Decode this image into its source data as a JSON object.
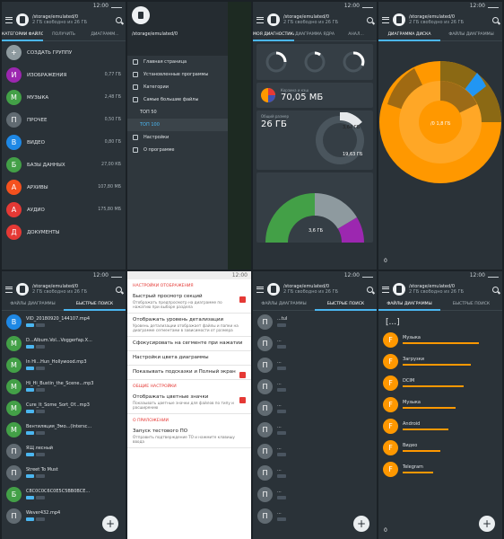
{
  "status": {
    "time": "12:00"
  },
  "header": {
    "path": "/storage/emulated/0",
    "sub": "2 ГБ свободно из 26 ГБ"
  },
  "panel1": {
    "tabs": [
      "КАТЕГОРИИ ФАЙЛОВ",
      "ПОЛУЧИТЬ",
      "ДИАГРАММ..."
    ],
    "items": [
      {
        "letter": "+",
        "label": "СОЗДАТЬ ГРУППУ",
        "size": "",
        "color": "#8e9a9f"
      },
      {
        "letter": "И",
        "label": "ИЗОБРАЖЕНИЯ",
        "size": "0,77 ГБ",
        "color": "#9c27b0"
      },
      {
        "letter": "М",
        "label": "МУЗЫКА",
        "size": "2,48 ГБ",
        "color": "#43a047"
      },
      {
        "letter": "П",
        "label": "ПРОЧЕЕ",
        "size": "0,50 ГБ",
        "color": "#616b72"
      },
      {
        "letter": "В",
        "label": "ВИДЕО",
        "size": "0,80 ГБ",
        "color": "#1e88e5"
      },
      {
        "letter": "Б",
        "label": "БАЗЫ ДАННЫХ",
        "size": "27,00 КБ",
        "color": "#43a047"
      },
      {
        "letter": "А",
        "label": "АРХИВЫ",
        "size": "107,80 МБ",
        "color": "#f4511e"
      },
      {
        "letter": "А",
        "label": "АУДИО",
        "size": "175,80 МБ",
        "color": "#e53935"
      },
      {
        "letter": "Д",
        "label": "ДОКУМЕНТЫ",
        "size": "",
        "color": "#e53935"
      }
    ]
  },
  "panel2": {
    "path": "/storage/emulated/0",
    "items": [
      "Главная страница",
      "Установленные программы",
      "Категории",
      "Самые большие файлы",
      "ТОП 50",
      "ТОП 100",
      "Настройки",
      "О программе"
    ]
  },
  "panel3": {
    "tabs": [
      "МОЯ ДИАГНОСТИКА",
      "ДИАГРАММА ЯДРА",
      "АНАЛ..."
    ],
    "trash_size": "70,05 МБ",
    "trash_label": "Корзина и кэш",
    "total_size": "26 ГБ",
    "total_label": "Общий размер",
    "free_size": "3,64 ГБ",
    "used_size": "19,63 ГБ",
    "free_label": "Свободно",
    "used_label": "Занято",
    "folder_size": "3,6 ГБ"
  },
  "panel4": {
    "tabs": [
      "ДИАГРАММА ДИСКА",
      "ФАЙЛЫ ДИАГРАММЫ"
    ],
    "center_label": "/0 1,8 ГБ",
    "bottom": "0"
  },
  "panel5": {
    "tabs": [
      "ФАЙЛЫ ДИАГРАММЫ",
      "БЫСТРЫЕ ПОИСК"
    ],
    "rows": [
      {
        "letter": "В",
        "name": "VID_20180920_144107.mp4",
        "color": "#1e88e5"
      },
      {
        "letter": "М",
        "name": "D...Album.Vol...Voggerfap.Х...",
        "color": "#43a047"
      },
      {
        "letter": "М",
        "name": "In Hi...Hun_Hollywood.mp3",
        "color": "#43a047"
      },
      {
        "letter": "М",
        "name": "Hi_Hi_Bustin_the_Scene...mp3",
        "color": "#43a047"
      },
      {
        "letter": "М",
        "name": "Cure_It_Some_Sort_Of...mp3",
        "color": "#43a047"
      },
      {
        "letter": "М",
        "name": "Вентиляция_Эмо...(Intersc...",
        "color": "#43a047"
      },
      {
        "letter": "П",
        "name": "ЯЩ лесный",
        "color": "#616b72"
      },
      {
        "letter": "П",
        "name": "Street To Must",
        "color": "#616b72"
      },
      {
        "letter": "Б",
        "name": "C8C0C0C6C0E5C5BB0BCE...",
        "color": "#43a047"
      },
      {
        "letter": "П",
        "name": "Wever432.mp4",
        "color": "#616b72"
      }
    ]
  },
  "panel6": {
    "head": "НАСТРОЙКИ ОТОБРАЖЕНИЯ",
    "blocks": [
      {
        "t": "Быстрый просмотр секций",
        "d": "Отображать предпросмотр на диаграмме по нажатию при выборе раздела",
        "chk": true
      },
      {
        "t": "Отображать уровень детализации",
        "d": "Уровень детализации отображает файлы и папки на диаграмме сегментами в зависимости от размера",
        "chk": false
      },
      {
        "t": "Сфокусировать на сегменте при нажатии",
        "d": "",
        "chk": false
      },
      {
        "t": "Настройки цвета диаграммы",
        "d": "",
        "chk": false
      },
      {
        "t": "Показывать подсказки и Полный экран",
        "d": "",
        "chk": true
      }
    ],
    "head2": "ОБЩИЕ НАСТРОЙКИ",
    "block2": {
      "t": "Отображать цветные значки",
      "d": "Показывать цветные значки для файлов по типу и расширению",
      "chk": true
    },
    "head3": "О ПРИЛОЖЕНИИ",
    "block3": {
      "t": "Запуск тестового ПО",
      "d": "Отправить подтверждение ТО и нажмите клавишу ввода"
    }
  },
  "panel7": {
    "tabs": [
      "ФАЙЛЫ ДИАГРАММЫ",
      "БЫСТРЫЕ ПОИСК"
    ],
    "rows": [
      "...tul",
      "...",
      "...",
      "...",
      "...",
      "...",
      "...",
      "...",
      "...",
      "..."
    ]
  },
  "panel8": {
    "tabs": [
      "ФАЙЛЫ ДИАГРАММЫ",
      "БЫСТРЫЕ ПОИСК"
    ],
    "back": "[...]",
    "rows": [
      "Музыка",
      "Загрузки",
      "DCIM",
      "Музыка",
      "Android",
      "Видео",
      "Telegram"
    ],
    "bottom": "0"
  }
}
